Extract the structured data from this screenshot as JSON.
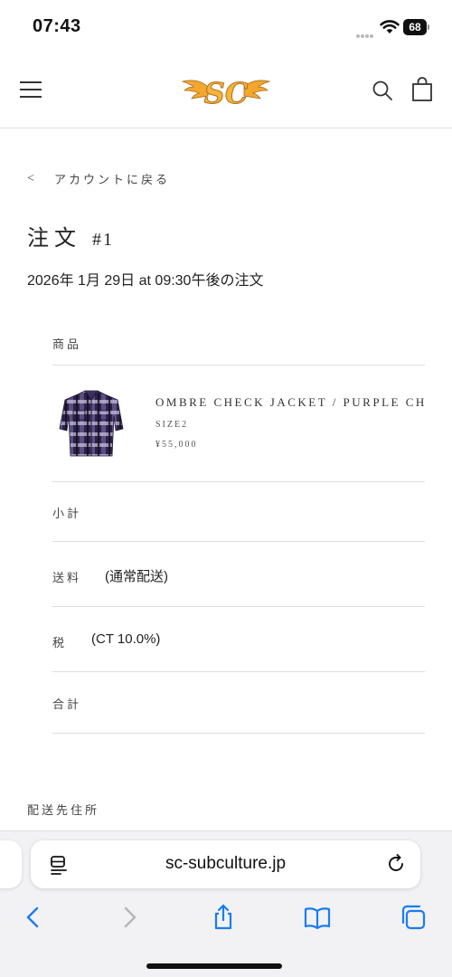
{
  "status_bar": {
    "time": "07:43",
    "battery": "68",
    "icons": [
      "signal-dots",
      "wifi-icon",
      "battery-icon"
    ]
  },
  "header": {
    "logo_text": "SC",
    "icons": [
      "menu-icon",
      "search-icon",
      "bag-icon"
    ],
    "logo_color": "#f2a72e"
  },
  "order": {
    "back_label": "アカウントに戻る",
    "title": "注文",
    "number": "#1",
    "date": "2026年 1月 29日 at 09:30午後の注文"
  },
  "items_section": {
    "header": "商品",
    "items": [
      {
        "name": "OMBRE CHECK JACKET / PURPLE CH",
        "variant": "SIZE2",
        "price": "¥55,000"
      }
    ]
  },
  "totals": {
    "subtotal_label": "小計",
    "shipping_label": "送料",
    "shipping_note": "(通常配送)",
    "tax_label": "税",
    "tax_note": "(CT 10.0%)",
    "total_label": "合計"
  },
  "shipping_address": {
    "header": "配送先住所"
  },
  "browser": {
    "url": "sc-subculture.jp",
    "toolbar": [
      "back-icon",
      "forward-icon",
      "share-icon",
      "bookmarks-icon",
      "tabs-icon"
    ],
    "accent_color": "#1a7cf5"
  }
}
